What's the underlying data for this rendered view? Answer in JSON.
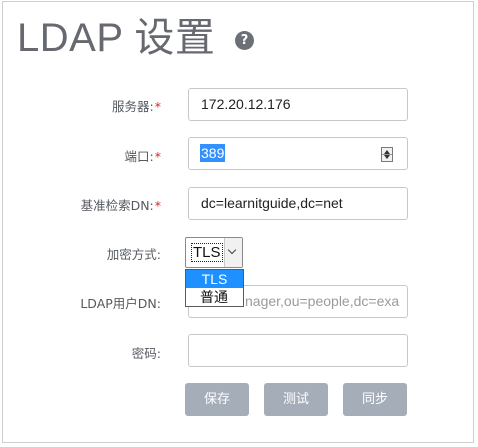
{
  "page": {
    "title": "LDAP 设置",
    "help_icon": "question-circle-icon",
    "help_glyph": "?"
  },
  "form": {
    "server": {
      "label": "服务器:",
      "required_mark": "*",
      "value": "172.20.12.176"
    },
    "port": {
      "label": "端口:",
      "required_mark": "*",
      "value": "389",
      "value_selected": true
    },
    "base_dn": {
      "label": "基准检索DN:",
      "required_mark": "*",
      "value": "dc=learnitguide,dc=net"
    },
    "encryption": {
      "label": "加密方式:",
      "selected": "TLS",
      "options": [
        "TLS",
        "普通"
      ],
      "highlighted_option": "TLS",
      "dropdown_open": true
    },
    "user_dn": {
      "label": "LDAP用户DN:",
      "placeholder_visible": "nager,ou=people,dc=exa",
      "value": ""
    },
    "password": {
      "label": "密码:",
      "value": ""
    }
  },
  "actions": {
    "save_label": "保存",
    "test_label": "测试",
    "sync_label": "同步"
  },
  "colors": {
    "title": "#666a70",
    "label": "#555a60",
    "required": "#d9242a",
    "button_bg": "#a5adb8",
    "selection": "#3390ff",
    "dropdown_highlight": "#1e90ff"
  }
}
